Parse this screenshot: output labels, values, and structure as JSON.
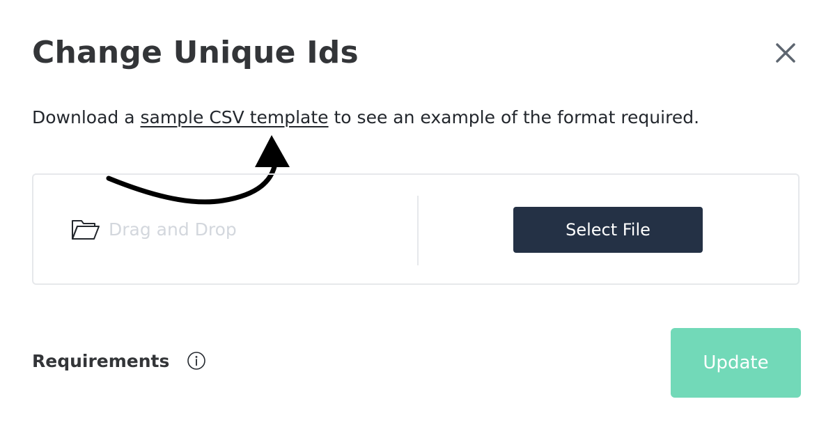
{
  "dialog": {
    "title": "Change Unique Ids",
    "close_icon": "close-icon"
  },
  "intro": {
    "prefix": "Download a ",
    "link_text": "sample CSV template",
    "suffix": " to see an example of the format required."
  },
  "annotation": {
    "icon": "curved-arrow-pointer"
  },
  "dropzone": {
    "icon": "folder-icon",
    "label": "Drag and Drop",
    "select_button_label": "Select File"
  },
  "footer": {
    "requirements_label": "Requirements",
    "info_icon": "info-icon",
    "update_button_label": "Update"
  },
  "colors": {
    "primary_dark": "#243145",
    "accent_green": "#72d9b8",
    "muted_text": "#d3d7dd",
    "border": "#e6e8eb"
  }
}
